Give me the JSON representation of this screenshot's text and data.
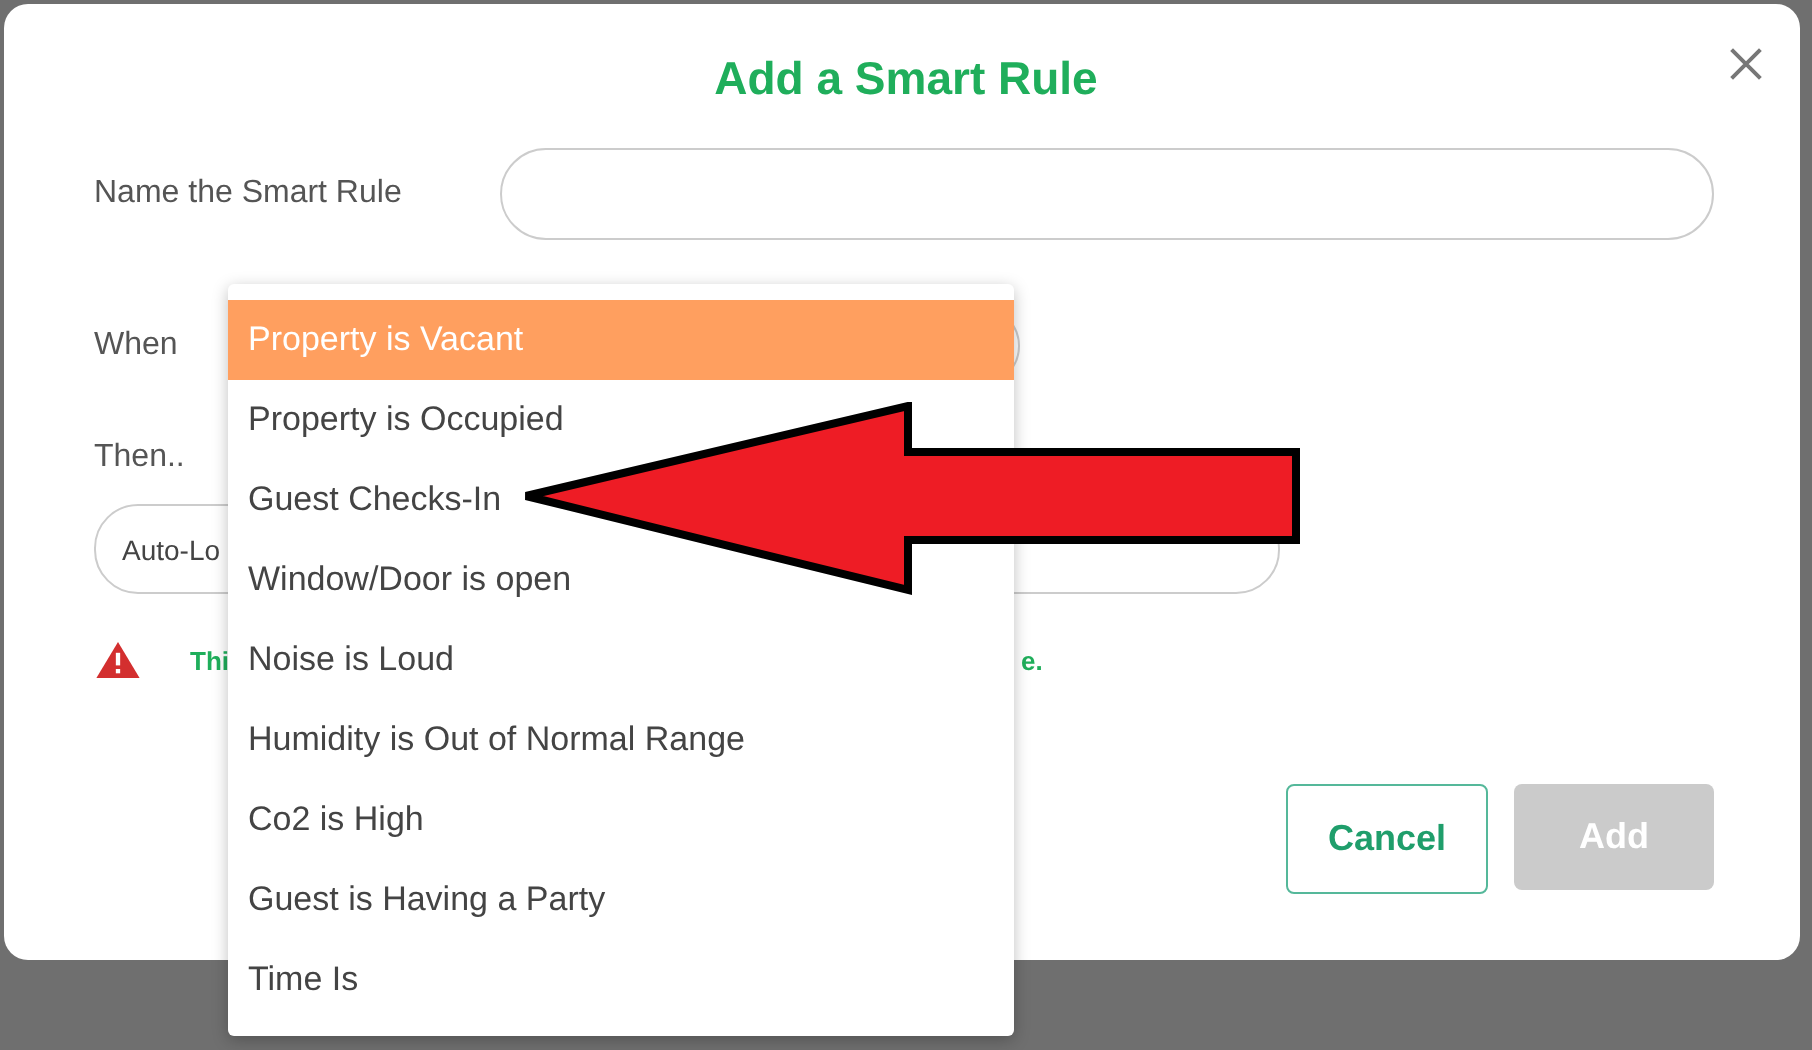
{
  "dialog": {
    "title": "Add a Smart Rule",
    "fields": [
      {
        "label": "Name the Smart Rule",
        "kind": "text"
      },
      {
        "label": "When",
        "kind": "select"
      },
      {
        "label": "Then..",
        "kind": "select",
        "value": "Auto-Lo"
      }
    ],
    "warning": {
      "parts": [
        "Thi",
        "e."
      ]
    },
    "buttons": [
      {
        "label": "Cancel",
        "kind": "outline",
        "disabled": false
      },
      {
        "label": "Add",
        "kind": "filled",
        "disabled": true
      }
    ]
  },
  "dropdown": {
    "options": [
      {
        "label": "Property is Vacant",
        "selected": true
      },
      {
        "label": "Property is Occupied",
        "selected": false
      },
      {
        "label": "Guest Checks-In",
        "selected": false
      },
      {
        "label": "Window/Door is open",
        "selected": false
      },
      {
        "label": "Noise is Loud",
        "selected": false
      },
      {
        "label": "Humidity is Out of Normal Range",
        "selected": false
      },
      {
        "label": "Co2 is High",
        "selected": false
      },
      {
        "label": "Guest is Having a Party",
        "selected": false
      },
      {
        "label": "Time Is",
        "selected": false
      }
    ]
  }
}
